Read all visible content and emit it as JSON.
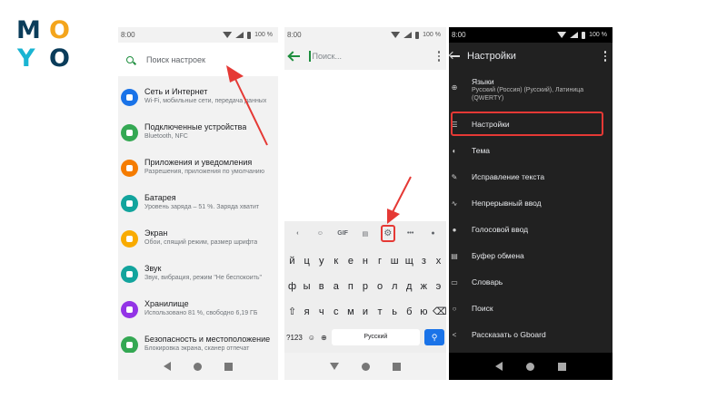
{
  "logo": {
    "l1": "M",
    "l2": "O",
    "l3": "Y",
    "l4": "O"
  },
  "status": {
    "time": "8:00",
    "battery": "100 %"
  },
  "phone1": {
    "search_placeholder": "Поиск настроек",
    "items": [
      {
        "title": "Сеть и Интернет",
        "sub": "Wi-Fi, мобильные сети, передача данных",
        "color": "#1a73e8",
        "icon": "wifi-icon"
      },
      {
        "title": "Подключенные устройства",
        "sub": "Bluetooth, NFC",
        "color": "#34a853",
        "icon": "devices-icon"
      },
      {
        "title": "Приложения и уведомления",
        "sub": "Разрешения, приложения по умолчанию",
        "color": "#f57c00",
        "icon": "apps-icon"
      },
      {
        "title": "Батарея",
        "sub": "Уровень заряда – 51 %. Заряда хватит",
        "color": "#12a49d",
        "icon": "battery-icon"
      },
      {
        "title": "Экран",
        "sub": "Обои, спящий режим, размер шрифта",
        "color": "#f9ab00",
        "icon": "display-icon"
      },
      {
        "title": "Звук",
        "sub": "Звук, вибрация, режим \"Не беспокоить\"",
        "color": "#12a49d",
        "icon": "sound-icon"
      },
      {
        "title": "Хранилище",
        "sub": "Использовано 81 %, свободно 6,19 ГБ",
        "color": "#9334e6",
        "icon": "storage-icon"
      },
      {
        "title": "Безопасность и местоположение",
        "sub": "Блокировка экрана, сканер отпечат",
        "color": "#34a853",
        "icon": "lock-icon"
      }
    ]
  },
  "phone2": {
    "search_placeholder": "Поиск...",
    "toolbar": {
      "gif": "GIF",
      "more": "•••"
    },
    "rows": [
      [
        "й",
        "ц",
        "у",
        "к",
        "е",
        "н",
        "г",
        "ш",
        "щ",
        "з",
        "х"
      ],
      [
        "ф",
        "ы",
        "в",
        "а",
        "п",
        "р",
        "о",
        "л",
        "д",
        "ж",
        "э"
      ],
      [
        "я",
        "ч",
        "с",
        "м",
        "и",
        "т",
        "ь",
        "б",
        "ю"
      ]
    ],
    "key_123": "?123",
    "space_label": "Русский"
  },
  "phone3": {
    "title": "Настройки",
    "languages_title": "Языки",
    "languages_sub": "Русский (Россия) (Русский), Латиница (QWERTY)",
    "items": [
      {
        "label": "Настройки",
        "icon": "sliders-icon"
      },
      {
        "label": "Тема",
        "icon": "palette-icon"
      },
      {
        "label": "Исправление текста",
        "icon": "text-correction-icon"
      },
      {
        "label": "Непрерывный ввод",
        "icon": "gesture-typing-icon"
      },
      {
        "label": "Голосовой ввод",
        "icon": "mic-icon"
      },
      {
        "label": "Буфер обмена",
        "icon": "clipboard-icon"
      },
      {
        "label": "Словарь",
        "icon": "dictionary-icon"
      },
      {
        "label": "Поиск",
        "icon": "search-icon"
      },
      {
        "label": "Рассказать о Gboard",
        "icon": "share-icon"
      }
    ]
  },
  "colors": {
    "highlight": "#e53935",
    "accent_green": "#1e8e3e",
    "dark_bg": "#212121"
  }
}
